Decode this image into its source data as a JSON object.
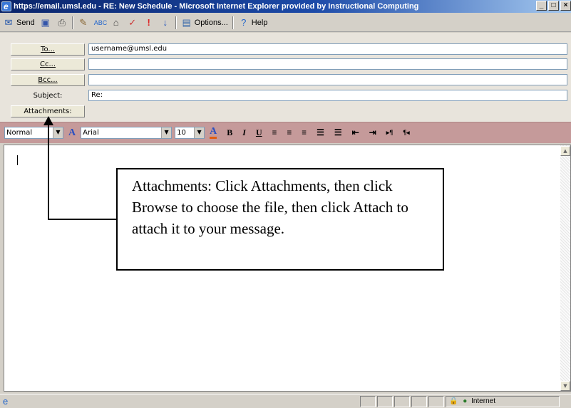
{
  "window": {
    "title": "https://email.umsl.edu - RE: New Schedule - Microsoft Internet Explorer provided by Instructional Computing",
    "controls": [
      "_",
      "□",
      "×"
    ]
  },
  "toolbar": {
    "send_label": "Send",
    "options_label": "Options...",
    "help_label": "Help"
  },
  "header": {
    "to_label": "To...",
    "cc_label": "Cc...",
    "bcc_label": "Bcc...",
    "subject_label": "Subject:",
    "attachments_label": "Attachments:",
    "to_value": "username@umsl.edu",
    "cc_value": "",
    "bcc_value": "",
    "subject_value": "Re:"
  },
  "format": {
    "style": "Normal",
    "font": "Arial",
    "size": "10",
    "buttons": [
      "B",
      "I",
      "U"
    ]
  },
  "callout": {
    "text": "Attachments: Click Attachments, then click Browse to choose the file, then click Attach to attach it to your message."
  },
  "status": {
    "zone": "Internet"
  }
}
